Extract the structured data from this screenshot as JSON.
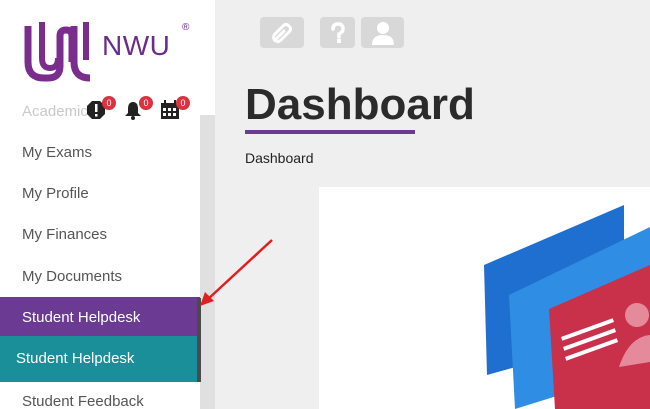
{
  "logo": {
    "text": "NWU",
    "reg": "®"
  },
  "sidebar": {
    "peek_item": "Academic",
    "notifications": [
      {
        "icon": "alert-icon",
        "count": "0"
      },
      {
        "icon": "bell-icon",
        "count": "0"
      },
      {
        "icon": "calendar-icon",
        "count": "0"
      }
    ],
    "items": [
      {
        "label": "My Exams"
      },
      {
        "label": "My Profile"
      },
      {
        "label": "My Finances"
      },
      {
        "label": "My Documents"
      },
      {
        "label": "Student Helpdesk"
      },
      {
        "label": "Student Helpdesk"
      },
      {
        "label": "Student Feedback"
      }
    ]
  },
  "toolbar": {
    "icons": [
      "link-icon",
      "help-icon",
      "user-icon"
    ]
  },
  "main": {
    "title": "Dashboard",
    "breadcrumb": "Dashboard"
  },
  "colors": {
    "brand_purple": "#6b2c91",
    "active_purple": "#6b3a92",
    "teal": "#1a8f9a",
    "badge_red": "#d9333f",
    "arrow_red": "#e02020"
  }
}
